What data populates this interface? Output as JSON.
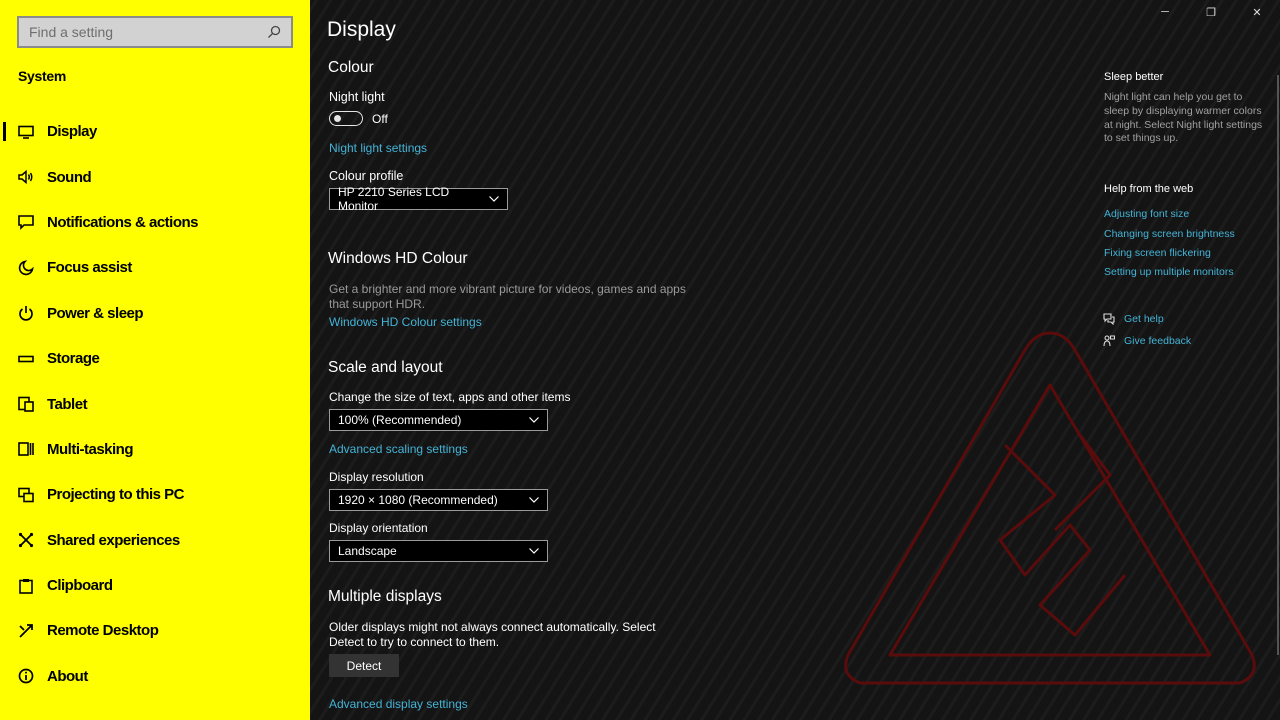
{
  "search": {
    "placeholder": "Find a setting"
  },
  "sidebar": {
    "title": "System",
    "items": [
      {
        "label": "Display",
        "icon": "monitor-icon"
      },
      {
        "label": "Sound",
        "icon": "speaker-icon"
      },
      {
        "label": "Notifications & actions",
        "icon": "notification-icon"
      },
      {
        "label": "Focus assist",
        "icon": "moon-icon"
      },
      {
        "label": "Power & sleep",
        "icon": "power-icon"
      },
      {
        "label": "Storage",
        "icon": "storage-icon"
      },
      {
        "label": "Tablet",
        "icon": "tablet-icon"
      },
      {
        "label": "Multi-tasking",
        "icon": "multitasking-icon"
      },
      {
        "label": "Projecting to this PC",
        "icon": "projecting-icon"
      },
      {
        "label": "Shared experiences",
        "icon": "shared-icon"
      },
      {
        "label": "Clipboard",
        "icon": "clipboard-icon"
      },
      {
        "label": "Remote Desktop",
        "icon": "remote-desktop-icon"
      },
      {
        "label": "About",
        "icon": "info-icon"
      }
    ],
    "active": "Display"
  },
  "main": {
    "title": "Display",
    "colour": {
      "heading": "Colour",
      "night_light_label": "Night light",
      "night_light_state": "Off",
      "night_light_link": "Night light settings",
      "profile_label": "Colour profile",
      "profile_value": "HP 2210 Series LCD Monitor"
    },
    "hd": {
      "heading": "Windows HD Colour",
      "desc_line1": "Get a brighter and more vibrant picture for videos, games and apps",
      "desc_line2": "that support HDR.",
      "link": "Windows HD Colour settings"
    },
    "scale": {
      "heading": "Scale and layout",
      "size_label": "Change the size of text, apps and other items",
      "size_value": "100% (Recommended)",
      "advanced_link": "Advanced scaling settings",
      "resolution_label": "Display resolution",
      "resolution_value": "1920 × 1080 (Recommended)",
      "orientation_label": "Display orientation",
      "orientation_value": "Landscape"
    },
    "multiple": {
      "heading": "Multiple displays",
      "desc_line1": "Older displays might not always connect automatically. Select",
      "desc_line2": "Detect to try to connect to them.",
      "detect_button": "Detect",
      "advanced_link": "Advanced display settings"
    }
  },
  "right": {
    "sleep_heading": "Sleep better",
    "sleep_desc_1": "Night light can help you get to",
    "sleep_desc_2": "sleep by displaying warmer colors",
    "sleep_desc_3": "at night. Select Night light settings",
    "sleep_desc_4": "to set things up.",
    "web_heading": "Help from the web",
    "web_links": [
      "Adjusting font size",
      "Changing screen brightness",
      "Fixing screen flickering",
      "Setting up multiple monitors"
    ],
    "get_help": "Get help",
    "give_feedback": "Give feedback"
  },
  "colors": {
    "sidebar_bg": "#ffff00",
    "accent_link": "#43b3d6",
    "watermark": "#5a0c0c"
  }
}
